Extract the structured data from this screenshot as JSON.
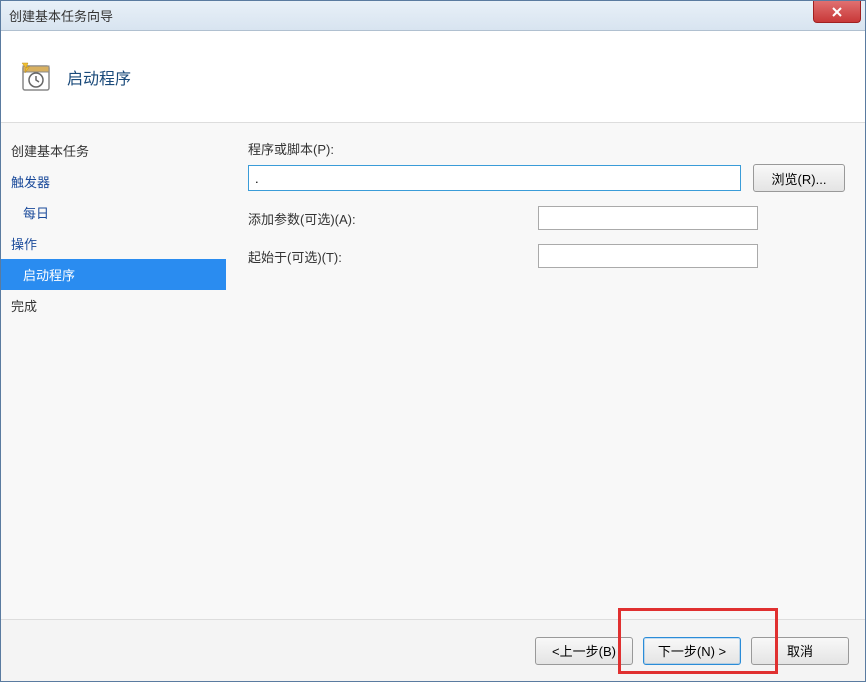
{
  "window": {
    "title": "创建基本任务向导"
  },
  "header": {
    "title": "启动程序"
  },
  "sidebar": {
    "items": [
      {
        "label": "创建基本任务",
        "level": 1,
        "selected": false,
        "style": "plain"
      },
      {
        "label": "触发器",
        "level": 1,
        "selected": false,
        "style": "link"
      },
      {
        "label": "每日",
        "level": 2,
        "selected": false,
        "style": "link"
      },
      {
        "label": "操作",
        "level": 1,
        "selected": false,
        "style": "link"
      },
      {
        "label": "启动程序",
        "level": 2,
        "selected": true,
        "style": "link"
      },
      {
        "label": "完成",
        "level": 1,
        "selected": false,
        "style": "plain"
      }
    ]
  },
  "form": {
    "program_label": "程序或脚本(P):",
    "program_value": ".",
    "browse_label": "浏览(R)...",
    "args_label": "添加参数(可选)(A):",
    "args_value": "",
    "startin_label": "起始于(可选)(T):",
    "startin_value": ""
  },
  "footer": {
    "back": "<上一步(B)",
    "next": "下一步(N) >",
    "cancel": "取消"
  }
}
